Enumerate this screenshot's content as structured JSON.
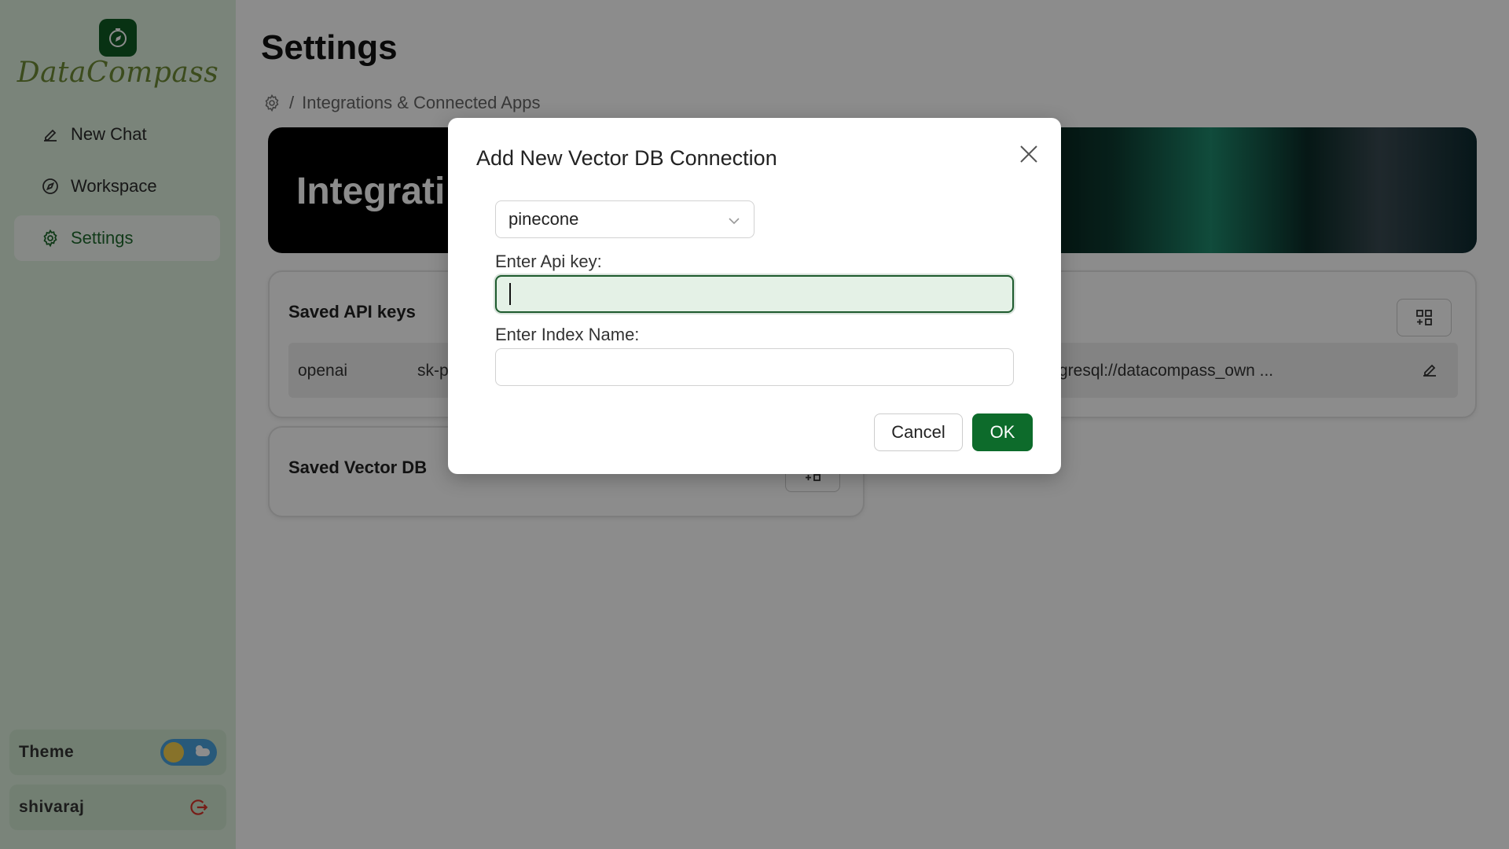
{
  "sidebar": {
    "brand": "DataCompass",
    "items": [
      {
        "label": "New Chat",
        "icon": "pencil-icon"
      },
      {
        "label": "Workspace",
        "icon": "compass-icon"
      },
      {
        "label": "Settings",
        "icon": "gear-icon"
      }
    ],
    "active_item": "Settings",
    "theme_label": "Theme",
    "user_name": "shivaraj"
  },
  "page": {
    "title": "Settings",
    "breadcrumb_current": "Integrations & Connected Apps",
    "hero_title": "Integrati",
    "saved_api_keys": {
      "heading": "Saved API keys",
      "row": {
        "provider": "openai",
        "key_preview": "sk-p",
        "connection_preview": "gresql://datacompass_own ..."
      }
    },
    "saved_vector_db": {
      "heading": "Saved Vector DB"
    }
  },
  "modal": {
    "title": "Add New Vector DB Connection",
    "provider_selected": "pinecone",
    "api_key_label": "Enter Api key:",
    "api_key_value": "",
    "index_name_label": "Enter Index Name:",
    "index_name_value": "",
    "cancel_label": "Cancel",
    "ok_label": "OK"
  },
  "colors": {
    "accent": "#0d6b2b",
    "sidebar_bg": "#dff0df",
    "brand_text": "#6e8a36",
    "logout": "#d9342b"
  }
}
